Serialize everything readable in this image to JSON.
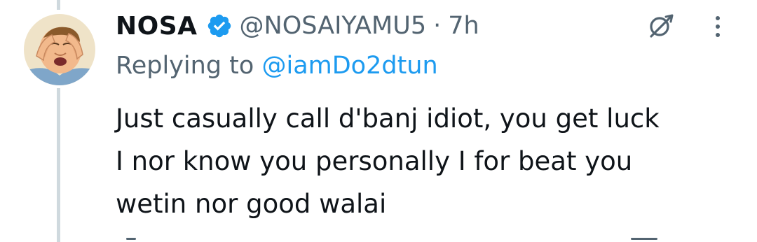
{
  "tweet": {
    "author": {
      "display_name": "NOSA",
      "handle": "@NOSAIYAMU5",
      "verified": true,
      "avatar_icon": "cartoon-man-avatar"
    },
    "separator": "·",
    "time": "7h",
    "reply": {
      "prefix": "Replying to",
      "to_handle": "@iamDo2dtun"
    },
    "text": "Just casually call d'banj idiot, you get luck\nI nor know you personally I for beat you\nwetin nor good walai",
    "icons": {
      "grok": "grok-icon",
      "more": "more-options-icon",
      "verified": "verified-badge-icon"
    }
  },
  "colors": {
    "text": "#0f1419",
    "secondary": "#536471",
    "link": "#1d9bf0",
    "thread_line": "#cfd9de",
    "verified": "#1d9bf0"
  }
}
